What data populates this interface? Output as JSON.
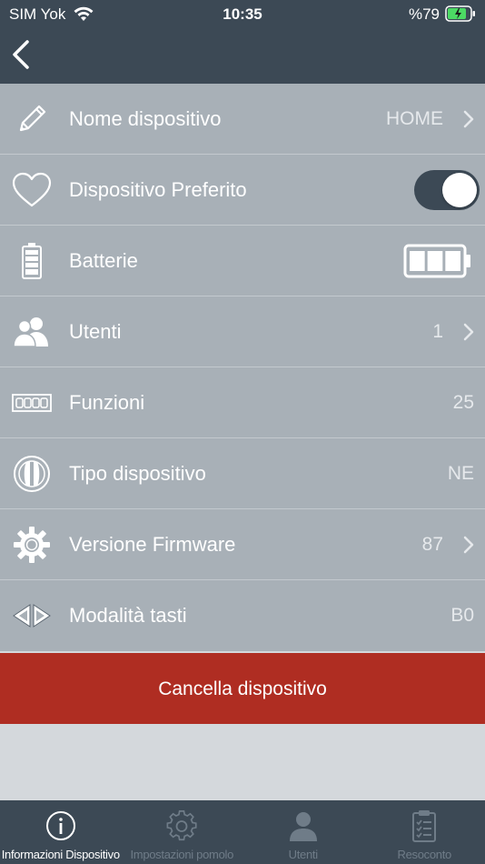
{
  "status_bar": {
    "carrier": "SIM Yok",
    "time": "10:35",
    "battery_percent": "%79"
  },
  "nav": {
    "back_icon": "chevron-left-icon"
  },
  "rows": [
    {
      "label": "Nome dispositivo",
      "value": "HOME",
      "icon": "pencil-icon",
      "has_chevron": true
    },
    {
      "label": "Dispositivo Preferito",
      "icon": "heart-icon",
      "toggle_on": true
    },
    {
      "label": "Batterie",
      "icon": "battery-vertical-icon",
      "battery_level_bars": 3,
      "battery_max_bars": 3
    },
    {
      "label": "Utenti",
      "value": "1",
      "icon": "users-icon",
      "has_chevron": true
    },
    {
      "label": "Funzioni",
      "value": "25",
      "icon": "keypad-icon",
      "has_chevron": false
    },
    {
      "label": "Tipo dispositivo",
      "value": "NE",
      "icon": "knob-icon",
      "has_chevron": false
    },
    {
      "label": "Versione Firmware",
      "value": "87",
      "icon": "gear-icon",
      "has_chevron": true
    },
    {
      "label": "Modalità tasti",
      "value": "B0",
      "icon": "arrows-left-right-icon",
      "has_chevron": false
    }
  ],
  "delete_button": {
    "label": "Cancella dispositivo"
  },
  "tabs": [
    {
      "label": "Informazioni Dispositivo",
      "icon": "info-icon",
      "active": true
    },
    {
      "label": "Impostazioni pomolo",
      "icon": "gear-icon",
      "active": false
    },
    {
      "label": "Utenti",
      "icon": "user-icon",
      "active": false
    },
    {
      "label": "Resoconto",
      "icon": "clipboard-icon",
      "active": false
    }
  ],
  "colors": {
    "header_bg": "#3c4955",
    "list_bg": "#a8b0b7",
    "delete_bg": "#af2d22",
    "tab_inactive": "#6f7c88",
    "tab_active": "#ffffff"
  }
}
